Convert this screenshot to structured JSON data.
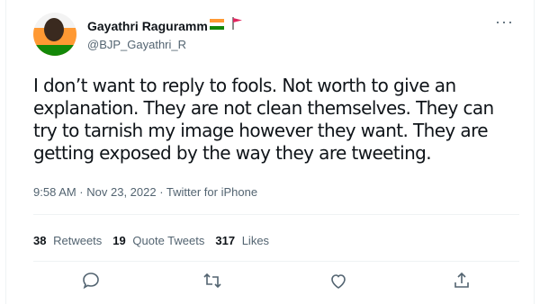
{
  "tweet": {
    "author_name": "Gayathri Raguramm",
    "handle": "@BJP_Gayathri_R",
    "more_label": "···",
    "text": "I don’t want to reply to fools. Not worth to give an explanation. They are not clean themselves. They can try to tarnish my image however they want. They are getting exposed by the way they are tweeting.",
    "meta": "9:58 AM · Nov 23, 2022 · Twitter for iPhone"
  },
  "stats": {
    "retweets_count": "38",
    "retweets_label": "Retweets",
    "quotes_count": "19",
    "quotes_label": "Quote Tweets",
    "likes_count": "317",
    "likes_label": "Likes"
  },
  "colors": {
    "text": "#0f1419",
    "muted": "#536471",
    "border": "#eff3f4",
    "flag_saffron": "#ff9933",
    "flag_green": "#138808",
    "red_flag": "#e0245e"
  },
  "icons": [
    "reply-icon",
    "retweet-icon",
    "like-icon",
    "share-icon",
    "india-flag-icon",
    "red-flag-icon"
  ]
}
